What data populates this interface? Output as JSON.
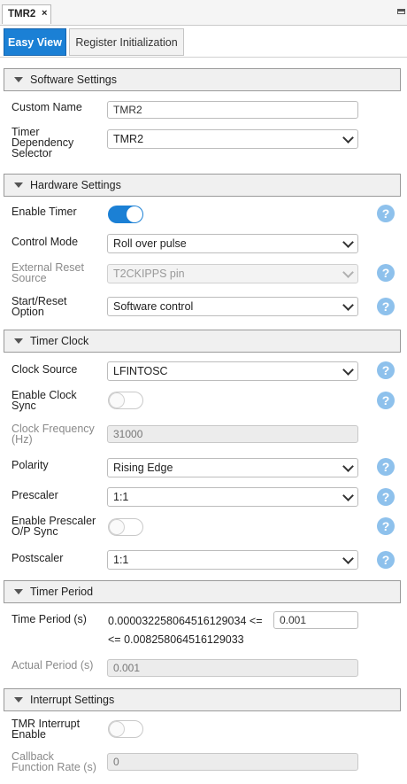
{
  "document_tab": {
    "title": "TMR2",
    "close": "×"
  },
  "view_tabs": {
    "easy_view": "Easy View",
    "register_init": "Register Initialization"
  },
  "sections": {
    "software": "Software Settings",
    "hardware": "Hardware Settings",
    "clock": "Timer Clock",
    "period": "Timer Period",
    "interrupt": "Interrupt Settings"
  },
  "software": {
    "custom_name_label": "Custom Name",
    "custom_name_value": "TMR2",
    "dependency_label_1": "Timer",
    "dependency_label_2": "Dependency",
    "dependency_label_3": "Selector",
    "dependency_value": "TMR2"
  },
  "hardware": {
    "enable_timer_label": "Enable Timer",
    "enable_timer_on": true,
    "control_mode_label": "Control Mode",
    "control_mode_value": "Roll over pulse",
    "ext_reset_label_1": "External Reset",
    "ext_reset_label_2": "Source",
    "ext_reset_value": "T2CKIPPS pin",
    "start_reset_label_1": "Start/Reset",
    "start_reset_label_2": "Option",
    "start_reset_value": "Software control"
  },
  "clock": {
    "clock_source_label": "Clock Source",
    "clock_source_value": "LFINTOSC",
    "clock_sync_label_1": "Enable Clock",
    "clock_sync_label_2": "Sync",
    "clock_sync_on": false,
    "clock_freq_label_1": "Clock Frequency",
    "clock_freq_label_2": "(Hz)",
    "clock_freq_value": "31000",
    "polarity_label": "Polarity",
    "polarity_value": "Rising Edge",
    "prescaler_label": "Prescaler",
    "prescaler_value": "1:1",
    "prescaler_sync_label_1": "Enable Prescaler",
    "prescaler_sync_label_2": "O/P Sync",
    "prescaler_sync_on": false,
    "postscaler_label": "Postscaler",
    "postscaler_value": "1:1"
  },
  "period": {
    "time_period_label": "Time Period (s)",
    "min_text": "0.000032258064516129034 <=",
    "value": "0.001",
    "max_text": "<= 0.008258064516129033",
    "actual_label": "Actual Period (s)",
    "actual_value": "0.001"
  },
  "interrupt": {
    "enable_label_1": "TMR Interrupt",
    "enable_label_2": "Enable",
    "enable_on": false,
    "callback_label_1": "Callback",
    "callback_label_2": "Function Rate (s)",
    "callback_value": "0"
  },
  "help_glyph": "?",
  "colors": {
    "accent": "#1b80d5",
    "help": "#8ec1ec"
  }
}
